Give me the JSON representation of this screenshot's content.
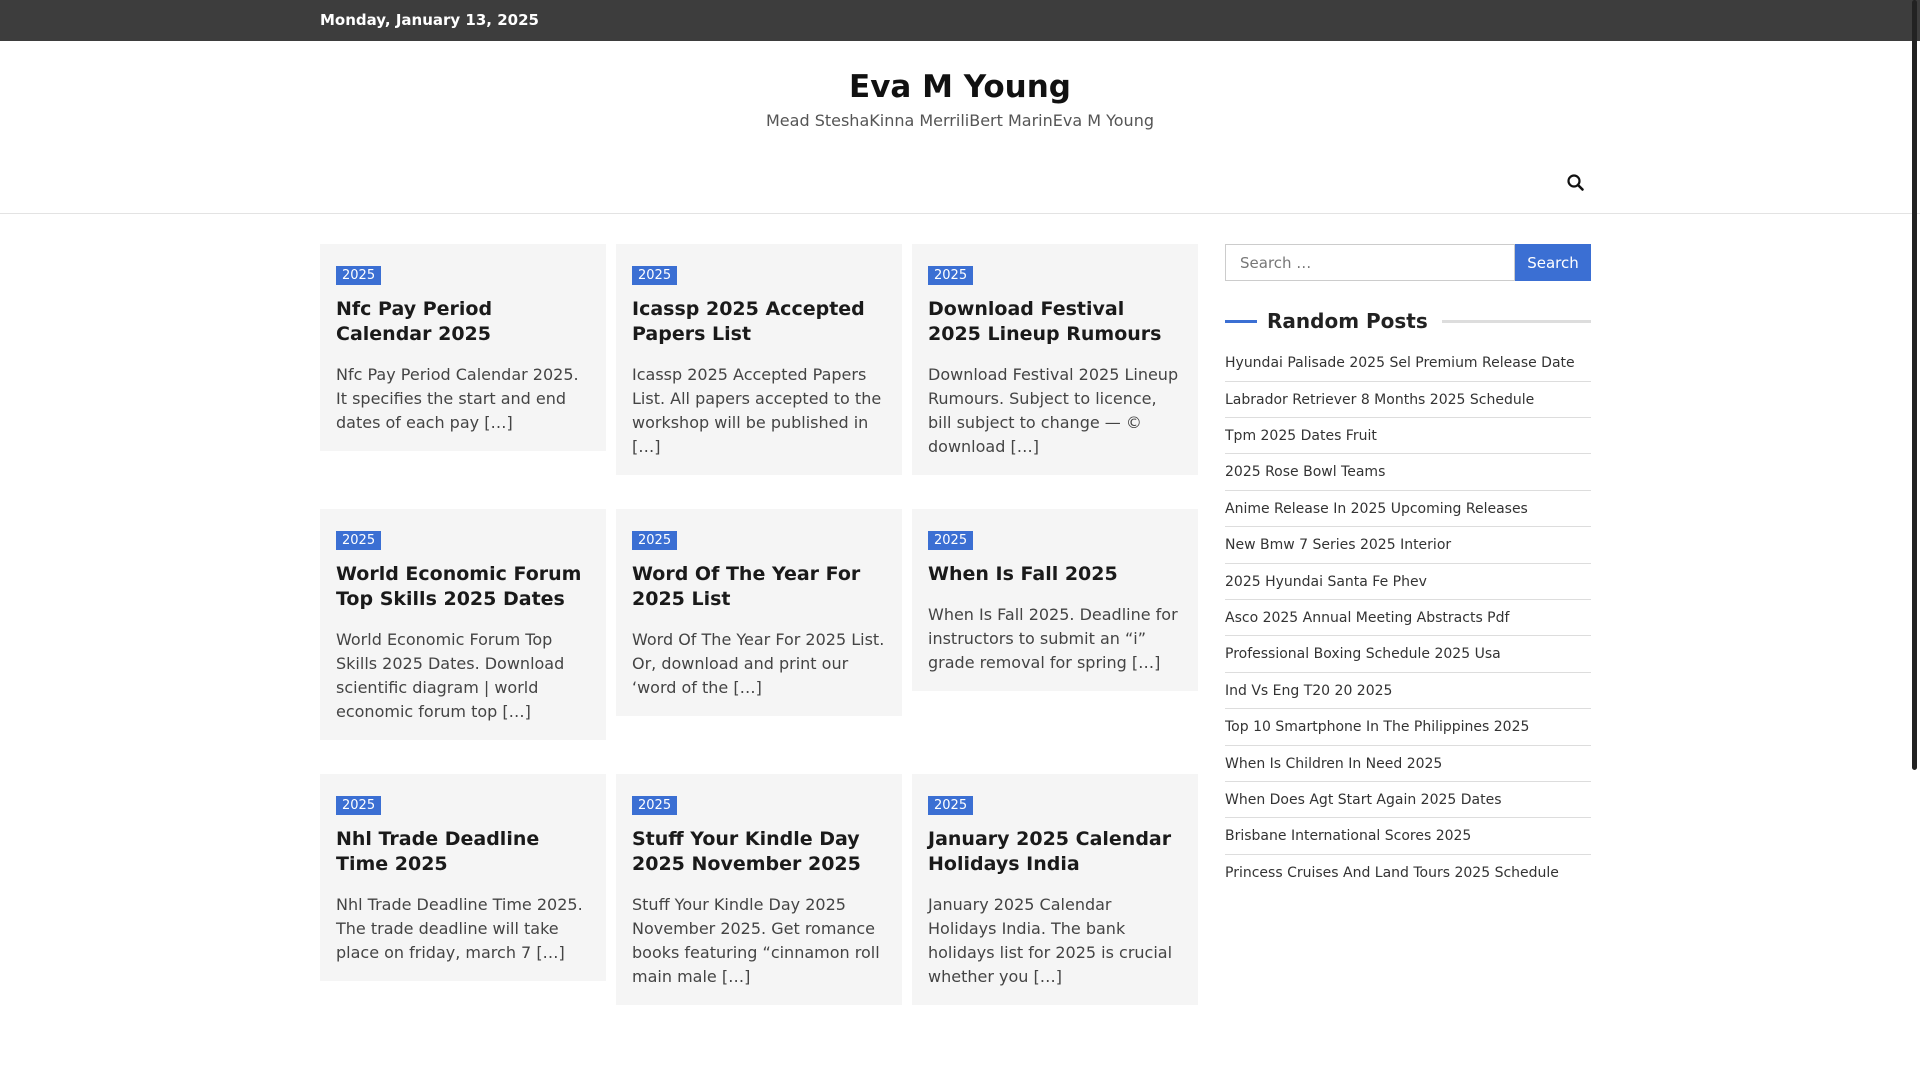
{
  "topbar": {
    "date": "Monday, January 13, 2025"
  },
  "site": {
    "title": "Eva M Young",
    "description": "Mead SteshaKinna MerriliBert MarinEva M Young"
  },
  "nav": {
    "search_icon": "search-icon"
  },
  "posts": [
    [
      {
        "badge": "2025",
        "title": "Nfc Pay Period Calendar 2025",
        "excerpt": "Nfc Pay Period Calendar 2025. It specifies the start and end dates of each pay […]"
      },
      {
        "badge": "2025",
        "title": "Icassp 2025 Accepted Papers List",
        "excerpt": "Icassp 2025 Accepted Papers List. All papers accepted to the workshop will be published in […]"
      },
      {
        "badge": "2025",
        "title": "Download Festival 2025 Lineup Rumours",
        "excerpt": "Download Festival 2025 Lineup Rumours. Subject to licence, bill subject to change — © download […]"
      }
    ],
    [
      {
        "badge": "2025",
        "title": "World Economic Forum Top Skills 2025 Dates",
        "excerpt": "World Economic Forum Top Skills 2025 Dates. Download scientific diagram | world economic forum top […]"
      },
      {
        "badge": "2025",
        "title": "Word Of The Year For 2025 List",
        "excerpt": "Word Of The Year For 2025 List. Or, download and print our ‘word of the […]"
      },
      {
        "badge": "2025",
        "title": "When Is Fall 2025",
        "excerpt": "When Is Fall 2025. Deadline for instructors to submit an “i” grade removal for spring […]"
      }
    ],
    [
      {
        "badge": "2025",
        "title": "Nhl Trade Deadline Time 2025",
        "excerpt": "Nhl Trade Deadline Time 2025. The trade deadline will take place on friday, march 7 […]"
      },
      {
        "badge": "2025",
        "title": "Stuff Your Kindle Day 2025 November 2025",
        "excerpt": "Stuff Your Kindle Day 2025 November 2025. Get romance books featuring “cinnamon roll main male […]"
      },
      {
        "badge": "2025",
        "title": "January 2025 Calendar Holidays India",
        "excerpt": "January 2025 Calendar Holidays India. The bank holidays list for 2025 is crucial whether you […]"
      }
    ]
  ],
  "sidebar": {
    "search": {
      "placeholder": "Search …",
      "button_label": "Search"
    },
    "widget_title": "Random Posts",
    "random_posts": [
      "Hyundai Palisade 2025 Sel Premium Release Date",
      "Labrador Retriever 8 Months 2025 Schedule",
      "Tpm 2025 Dates Fruit",
      "2025 Rose Bowl Teams",
      "Anime Release In 2025 Upcoming Releases",
      "New Bmw 7 Series 2025 Interior",
      "2025 Hyundai Santa Fe Phev",
      "Asco 2025 Annual Meeting Abstracts Pdf",
      "Professional Boxing Schedule 2025 Usa",
      "Ind Vs Eng T20 20 2025",
      "Top 10 Smartphone In The Philippines 2025",
      "When Is Children In Need 2025",
      "When Does Agt Start Again 2025 Dates",
      "Brisbane International Scores 2025",
      "Princess Cruises And Land Tours 2025 Schedule"
    ]
  },
  "colors": {
    "topbar_bg": "#3d3d3d",
    "accent": "#3b6fd3",
    "card_bg": "#f5f5f5"
  }
}
